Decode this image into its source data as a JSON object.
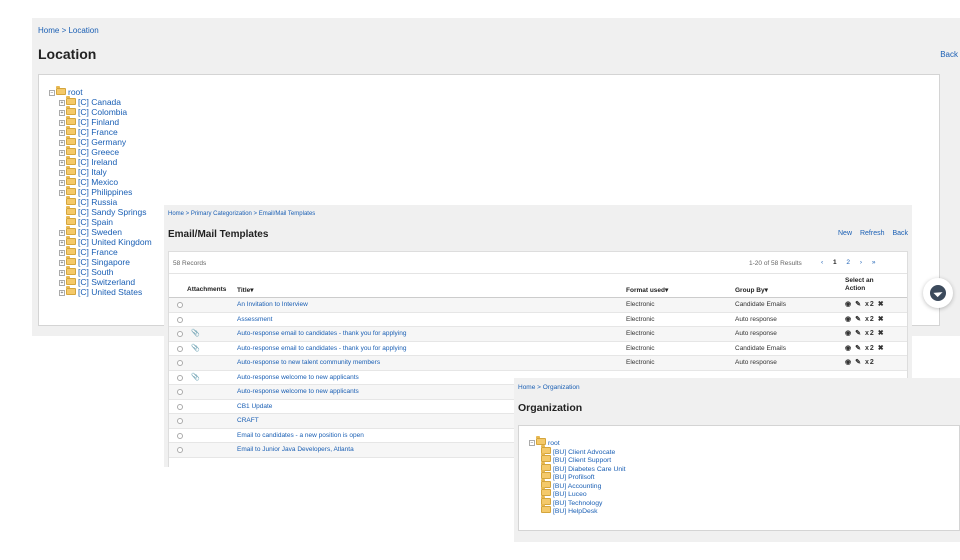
{
  "location": {
    "breadcrumb": "Home > Location",
    "title": "Location",
    "back": "Back",
    "root": "root",
    "nodes": [
      {
        "label": "[C] Canada",
        "expandable": true
      },
      {
        "label": "[C] Colombia",
        "expandable": true
      },
      {
        "label": "[C] Finland",
        "expandable": true
      },
      {
        "label": "[C] France",
        "expandable": true
      },
      {
        "label": "[C] Germany",
        "expandable": true
      },
      {
        "label": "[C] Greece",
        "expandable": true
      },
      {
        "label": "[C] Ireland",
        "expandable": true
      },
      {
        "label": "[C] Italy",
        "expandable": true
      },
      {
        "label": "[C] Mexico",
        "expandable": true
      },
      {
        "label": "[C] Philippines",
        "expandable": true
      },
      {
        "label": "[C] Russia",
        "expandable": false
      },
      {
        "label": "[C] Sandy Springs",
        "expandable": false
      },
      {
        "label": "[C] Spain",
        "expandable": false
      },
      {
        "label": "[C] Sweden",
        "expandable": true
      },
      {
        "label": "[C] United Kingdom",
        "expandable": true
      },
      {
        "label": "[C] France",
        "expandable": true
      },
      {
        "label": "[C] Singapore",
        "expandable": true
      },
      {
        "label": "[C] South",
        "expandable": true
      },
      {
        "label": "[C] Switzerland",
        "expandable": true
      },
      {
        "label": "[C] United States",
        "expandable": true
      }
    ]
  },
  "email": {
    "breadcrumb": "Home > Primary Categorization > Email/Mail Templates",
    "title": "Email/Mail Templates",
    "actions": {
      "new": "New",
      "refresh": "Refresh",
      "back": "Back"
    },
    "records": "58 Records",
    "results": "1-20 of 58 Results",
    "pager": {
      "prev": "‹",
      "page1": "1",
      "page2": "2",
      "next": "›",
      "last": "»"
    },
    "columns": {
      "attachments": "Attachments",
      "title": "Title▾",
      "format": "Format used▾",
      "group": "Group By▾",
      "action": "Select an Action"
    },
    "rows": [
      {
        "attach": false,
        "title": "An Invitation to Interview",
        "format": "Electronic",
        "group": "Candidate Emails",
        "actions": "full"
      },
      {
        "attach": false,
        "title": "Assessment",
        "format": "Electronic",
        "group": "Auto response",
        "actions": "full"
      },
      {
        "attach": true,
        "title": "Auto-response email to candidates - thank you for applying",
        "format": "Electronic",
        "group": "Auto response",
        "actions": "full"
      },
      {
        "attach": true,
        "title": "Auto-response email to candidates - thank you for applying",
        "format": "Electronic",
        "group": "Candidate Emails",
        "actions": "full"
      },
      {
        "attach": false,
        "title": "Auto-response to new talent community members",
        "format": "Electronic",
        "group": "Auto response",
        "actions": "partial"
      },
      {
        "attach": true,
        "title": "Auto-response welcome to new applicants",
        "format": "",
        "group": "",
        "actions": "none"
      },
      {
        "attach": false,
        "title": "Auto-response welcome to new applicants",
        "format": "",
        "group": "",
        "actions": "none"
      },
      {
        "attach": false,
        "title": "CB1 Update",
        "format": "",
        "group": "",
        "actions": "none"
      },
      {
        "attach": false,
        "title": "CRAFT",
        "format": "",
        "group": "",
        "actions": "none"
      },
      {
        "attach": false,
        "title": "Email to candidates - a new position is open",
        "format": "",
        "group": "",
        "actions": "none"
      },
      {
        "attach": false,
        "title": "Email to Junior Java Developers, Atlanta",
        "format": "",
        "group": "",
        "actions": "none"
      }
    ]
  },
  "organization": {
    "breadcrumb": "Home > Organization",
    "title": "Organization",
    "root": "root",
    "nodes": [
      "[BU] Client Advocate",
      "[BU] Client Support",
      "[BU] Diabetes Care Unit",
      "[BU] Profilsoft",
      "[BU] Accounting",
      "[BU] Luceo",
      "[BU] Technology",
      "[BU] HelpDesk"
    ]
  },
  "icons": {
    "view": "◉",
    "edit": "✎",
    "copy": "x2",
    "delete": "✖",
    "attachment": "📎"
  }
}
